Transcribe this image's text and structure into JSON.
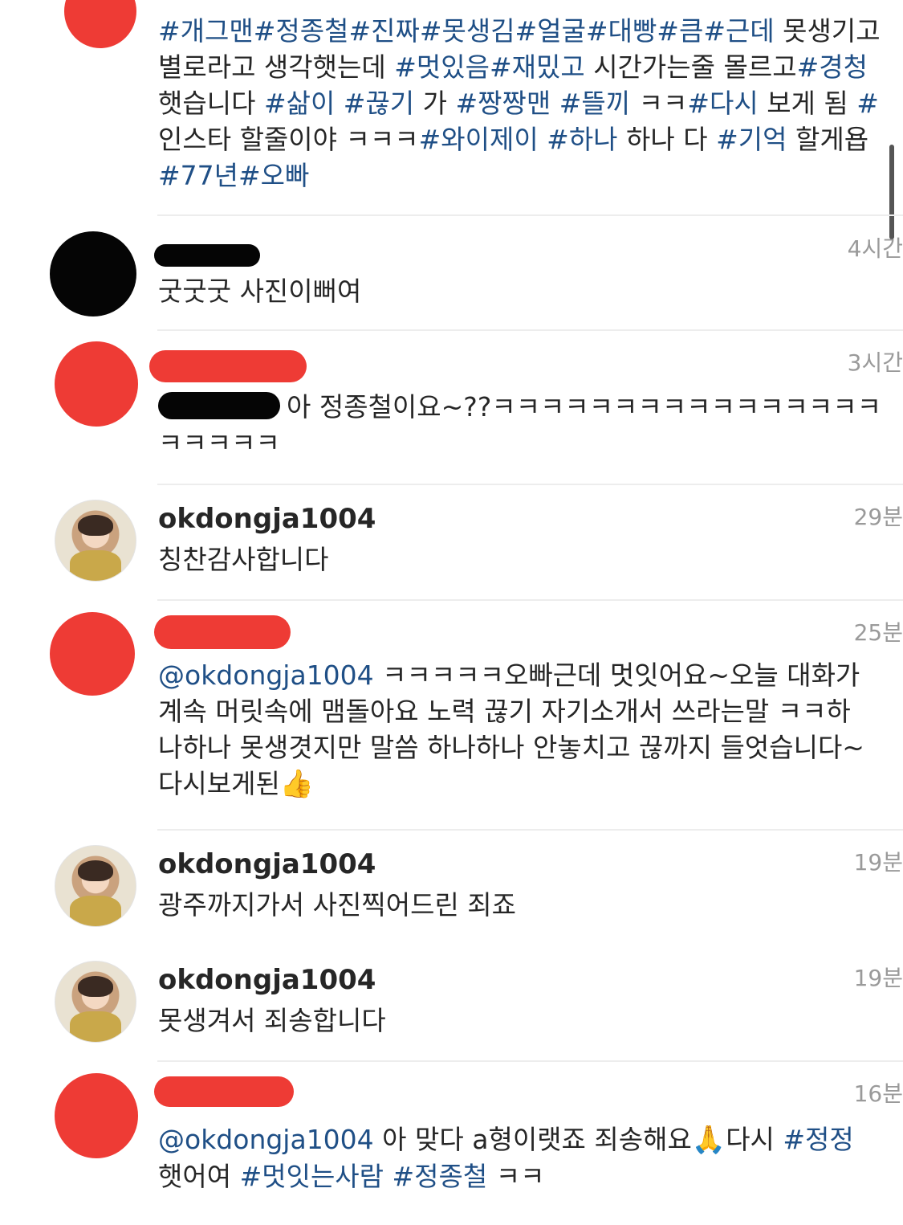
{
  "caption": {
    "lines": [
      [
        {
          "t": "#개그맨#정종철#진짜#못생김#얼굴#대빵#큼#근데",
          "tag": true
        },
        {
          "t": " 못생기고",
          "tag": false
        }
      ],
      [
        {
          "t": "별로라고 생각햇는데 ",
          "tag": false
        },
        {
          "t": "#멋있음#재밌고",
          "tag": true
        },
        {
          "t": " 시간가는줄 몰르고",
          "tag": false
        },
        {
          "t": "#경청",
          "tag": true
        }
      ],
      [
        {
          "t": "햇습니다 ",
          "tag": false
        },
        {
          "t": "#삶이 #끊기",
          "tag": true
        },
        {
          "t": " 가 ",
          "tag": false
        },
        {
          "t": "#짱짱맨 #뜰끼",
          "tag": true
        },
        {
          "t": " ㅋㅋ",
          "tag": false
        },
        {
          "t": "#다시",
          "tag": true
        },
        {
          "t": " 보게 됨 ",
          "tag": false
        },
        {
          "t": "#",
          "tag": true
        }
      ],
      [
        {
          "t": "인스타 할줄이야 ㅋㅋㅋ",
          "tag": false
        },
        {
          "t": "#와이제이 #하나",
          "tag": true
        },
        {
          "t": " 하나 다 ",
          "tag": false
        },
        {
          "t": "#기억",
          "tag": true
        },
        {
          "t": " 할게욥",
          "tag": false
        }
      ],
      [
        {
          "t": "#77년#오빠",
          "tag": true
        }
      ]
    ]
  },
  "comments": [
    {
      "time": "4시간",
      "lines": [
        [
          {
            "t": "굿굿굿 사진이뻐여",
            "tag": false
          }
        ]
      ]
    },
    {
      "time": "3시간",
      "lines": [
        [
          {
            "t": "아 정종철이요~??ㅋㅋㅋㅋㅋㅋㅋㅋㅋㅋㅋㅋㅋㅋㅋㅋ",
            "tag": false
          }
        ],
        [
          {
            "t": "ㅋㅋㅋㅋㅋ",
            "tag": false
          }
        ]
      ]
    },
    {
      "username": "okdongja1004",
      "time": "29분",
      "lines": [
        [
          {
            "t": "칭찬감사합니다",
            "tag": false
          }
        ]
      ]
    },
    {
      "time": "25분",
      "lines": [
        [
          {
            "t": "@okdongja1004",
            "tag": true
          },
          {
            "t": " ㅋㅋㅋㅋㅋ오빠근데 멋잇어요~오늘 대화가",
            "tag": false
          }
        ],
        [
          {
            "t": "계속 머릿속에 맴돌아요 노력 끊기 자기소개서 쓰라는말 ㅋㅋ하",
            "tag": false
          }
        ],
        [
          {
            "t": "나하나 못생겻지만 말씀 하나하나 안놓치고 끊까지 들엇습니다~",
            "tag": false
          }
        ],
        [
          {
            "t": "다시보게된",
            "tag": false
          },
          {
            "t": "👍",
            "tag": false,
            "emoji": true
          }
        ]
      ]
    },
    {
      "username": "okdongja1004",
      "time": "19분",
      "lines": [
        [
          {
            "t": "광주까지가서 사진찍어드린 죄죠",
            "tag": false
          }
        ]
      ]
    },
    {
      "username": "okdongja1004",
      "time": "19분",
      "lines": [
        [
          {
            "t": "못생겨서 죄송합니다",
            "tag": false
          }
        ]
      ]
    },
    {
      "time": "16분",
      "lines": [
        [
          {
            "t": "@okdongja1004",
            "tag": true
          },
          {
            "t": " 아 맞다 a형이랫죠 죄송해요",
            "tag": false
          },
          {
            "t": "🙏",
            "tag": false,
            "emoji": true
          },
          {
            "t": "다시 ",
            "tag": false
          },
          {
            "t": "#정정",
            "tag": true
          }
        ],
        [
          {
            "t": "햇어여 ",
            "tag": false
          },
          {
            "t": "#멋잇는사람 #정종철",
            "tag": true
          },
          {
            "t": " ㅋㅋ",
            "tag": false
          }
        ]
      ]
    }
  ],
  "colors": {
    "hashtag": "#1f4f86",
    "redaction": "#ee3b35",
    "timestamp": "#9a9a9a"
  },
  "icons": {
    "avatar_redacted": "red-circle",
    "avatar_photo": "profile-photo"
  }
}
